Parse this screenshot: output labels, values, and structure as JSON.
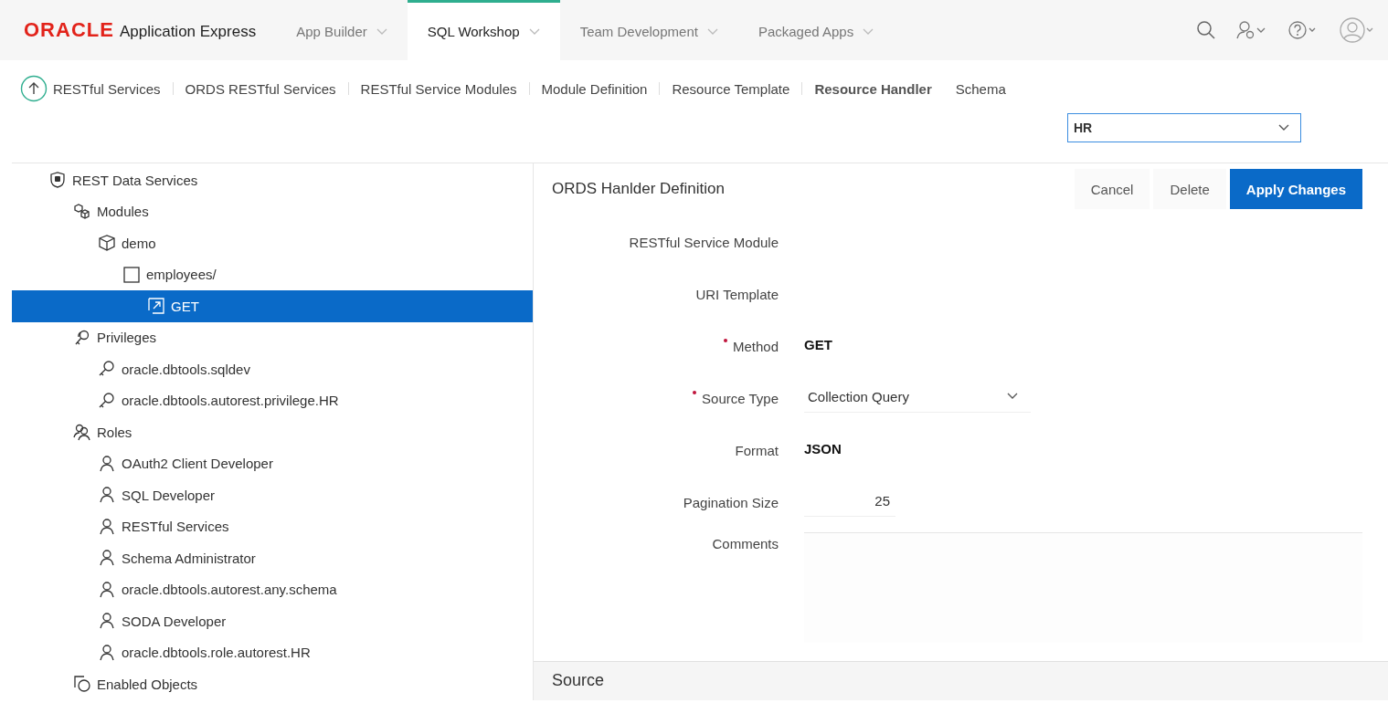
{
  "header": {
    "brand": "ORACLE",
    "product": "Application Express",
    "tabs": [
      {
        "label": "App Builder",
        "selected": false
      },
      {
        "label": "SQL Workshop",
        "selected": true
      },
      {
        "label": "Team Development",
        "selected": false
      },
      {
        "label": "Packaged Apps",
        "selected": false
      }
    ]
  },
  "breadcrumb": [
    {
      "label": "RESTful Services",
      "current": false
    },
    {
      "label": "ORDS RESTful Services",
      "current": false
    },
    {
      "label": "RESTful Service Modules",
      "current": false
    },
    {
      "label": "Module Definition",
      "current": false
    },
    {
      "label": "Resource Template",
      "current": false
    },
    {
      "label": "Resource Handler",
      "current": true
    }
  ],
  "schema": {
    "label": "Schema",
    "value": "HR"
  },
  "tree": [
    {
      "label": "REST Data Services",
      "kind": "shield",
      "selected": false,
      "children": [
        {
          "label": "Modules",
          "kind": "modules",
          "selected": false,
          "children": [
            {
              "label": "demo",
              "kind": "cube",
              "selected": false,
              "children": [
                {
                  "label": "employees/",
                  "kind": "template",
                  "selected": false,
                  "children": [
                    {
                      "label": "GET",
                      "kind": "handler",
                      "selected": true
                    }
                  ]
                }
              ]
            }
          ]
        },
        {
          "label": "Privileges",
          "kind": "privileges",
          "selected": false,
          "children": [
            {
              "label": "oracle.dbtools.sqldev",
              "kind": "privilege",
              "selected": false
            },
            {
              "label": "oracle.dbtools.autorest.privilege.HR",
              "kind": "privilege",
              "selected": false
            }
          ]
        },
        {
          "label": "Roles",
          "kind": "roles",
          "selected": false,
          "children": [
            {
              "label": "OAuth2 Client Developer",
              "kind": "role",
              "selected": false
            },
            {
              "label": "SQL Developer",
              "kind": "role",
              "selected": false
            },
            {
              "label": "RESTful Services",
              "kind": "role",
              "selected": false
            },
            {
              "label": "Schema Administrator",
              "kind": "role",
              "selected": false
            },
            {
              "label": "oracle.dbtools.autorest.any.schema",
              "kind": "role",
              "selected": false
            },
            {
              "label": "SODA Developer",
              "kind": "role",
              "selected": false
            },
            {
              "label": "oracle.dbtools.role.autorest.HR",
              "kind": "role",
              "selected": false
            }
          ]
        },
        {
          "label": "Enabled Objects",
          "kind": "objects",
          "selected": false
        }
      ]
    }
  ],
  "form": {
    "title": "ORDS Hanlder Definition",
    "buttons": [
      {
        "label": "Cancel",
        "kind": "plain"
      },
      {
        "label": "Delete",
        "kind": "plain"
      },
      {
        "label": "Apply Changes",
        "kind": "primary"
      }
    ],
    "fields": [
      {
        "label": "RESTful Service Module",
        "kind": "empty",
        "required": false
      },
      {
        "label": "URI Template",
        "kind": "empty",
        "required": false
      },
      {
        "label": "Method",
        "kind": "text",
        "required": true,
        "value": "GET"
      },
      {
        "label": "Source Type",
        "kind": "select",
        "required": true,
        "value": "Collection Query"
      },
      {
        "label": "Format",
        "kind": "text",
        "required": false,
        "value": "JSON"
      },
      {
        "label": "Pagination Size",
        "kind": "number",
        "required": false,
        "value": "25"
      },
      {
        "label": "Comments",
        "kind": "textarea",
        "required": false
      }
    ]
  },
  "source": {
    "title": "Source"
  }
}
